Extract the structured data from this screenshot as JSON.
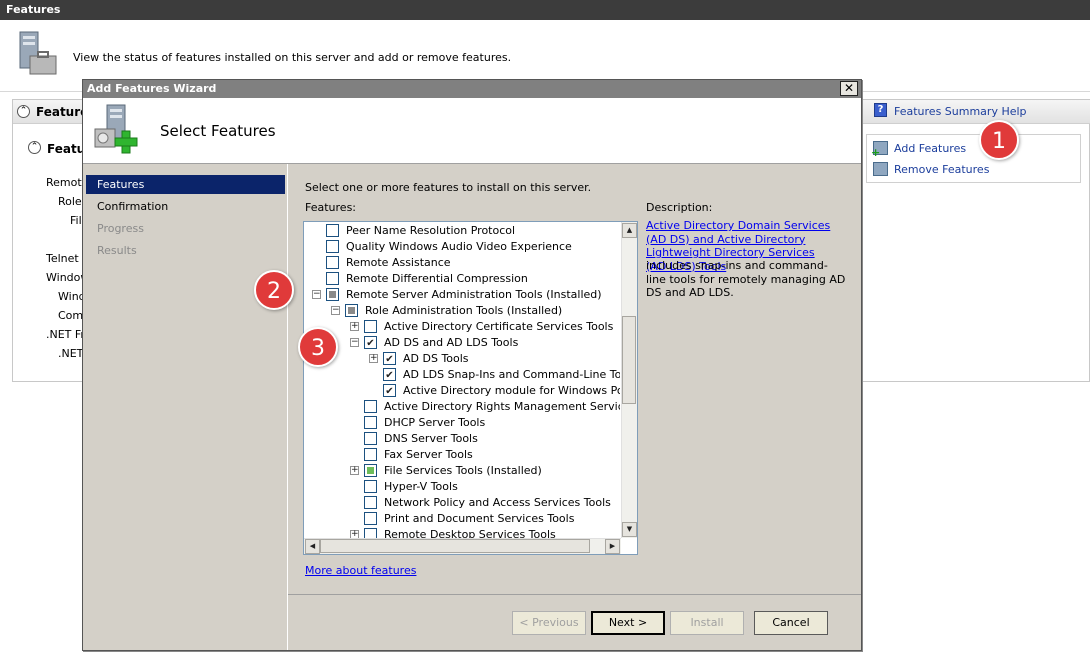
{
  "window": {
    "title": "Features",
    "description": "View the status of features installed on this server and add or remove features."
  },
  "background": {
    "section_title_1": "Features",
    "section_title_2": "Featur",
    "items": [
      "Remote",
      "Role",
      "Fil",
      "Telnet C",
      "Window",
      "Wind",
      "Comn",
      ".NET Fr",
      ".NET"
    ]
  },
  "actions": {
    "help": "Features Summary Help",
    "add": "Add Features",
    "remove": "Remove Features"
  },
  "dialog": {
    "title": "Add Features Wizard",
    "close": "✕",
    "heading": "Select Features",
    "nav": [
      "Features",
      "Confirmation",
      "Progress",
      "Results"
    ],
    "instruction": "Select one or more features to install on this server.",
    "features_label": "Features:",
    "description_label": "Description:",
    "description_link": "Active Directory Domain Services (AD DS) and Active Directory Lightweight Directory Services (AD LDS) Tools",
    "description_text": "includes snap-ins and command-line tools for remotely managing AD DS and AD LDS.",
    "more_link": "More about features",
    "buttons": {
      "previous": "< Previous",
      "next": "Next >",
      "install": "Install",
      "cancel": "Cancel"
    }
  },
  "tree": [
    {
      "label": "Peer Name Resolution Protocol",
      "level": 0,
      "expander": "",
      "state": "unchecked"
    },
    {
      "label": "Quality Windows Audio Video Experience",
      "level": 0,
      "expander": "",
      "state": "unchecked"
    },
    {
      "label": "Remote Assistance",
      "level": 0,
      "expander": "",
      "state": "unchecked"
    },
    {
      "label": "Remote Differential Compression",
      "level": 0,
      "expander": "",
      "state": "unchecked"
    },
    {
      "label": "Remote Server Administration Tools  (Installed)",
      "level": 0,
      "expander": "−",
      "state": "partial"
    },
    {
      "label": "Role Administration Tools  (Installed)",
      "level": 1,
      "expander": "−",
      "state": "partial"
    },
    {
      "label": "Active Directory Certificate Services Tools",
      "level": 2,
      "expander": "+",
      "state": "unchecked"
    },
    {
      "label": "AD DS and AD LDS Tools",
      "level": 2,
      "expander": "−",
      "state": "checked"
    },
    {
      "label": "AD DS Tools",
      "level": 3,
      "expander": "+",
      "state": "checked"
    },
    {
      "label": "AD LDS Snap-Ins and Command-Line Tools",
      "level": 3,
      "expander": "",
      "state": "checked"
    },
    {
      "label": "Active Directory module for Windows PowerSh",
      "level": 3,
      "expander": "",
      "state": "checked"
    },
    {
      "label": "Active Directory Rights Management Services Too",
      "level": 2,
      "expander": "",
      "state": "unchecked"
    },
    {
      "label": "DHCP Server Tools",
      "level": 2,
      "expander": "",
      "state": "unchecked"
    },
    {
      "label": "DNS Server Tools",
      "level": 2,
      "expander": "",
      "state": "unchecked"
    },
    {
      "label": "Fax Server Tools",
      "level": 2,
      "expander": "",
      "state": "unchecked"
    },
    {
      "label": "File Services Tools  (Installed)",
      "level": 2,
      "expander": "+",
      "state": "partial"
    },
    {
      "label": "Hyper-V Tools",
      "level": 2,
      "expander": "",
      "state": "unchecked"
    },
    {
      "label": "Network Policy and Access Services Tools",
      "level": 2,
      "expander": "",
      "state": "unchecked"
    },
    {
      "label": "Print and Document Services Tools",
      "level": 2,
      "expander": "",
      "state": "unchecked"
    },
    {
      "label": "Remote Desktop Services Tools",
      "level": 2,
      "expander": "+",
      "state": "unchecked"
    }
  ],
  "badges": [
    "1",
    "2",
    "3"
  ],
  "colors": {
    "selected_nav": "#0b246a",
    "link": "#1c3e9c",
    "badge": "#e03a3a"
  }
}
